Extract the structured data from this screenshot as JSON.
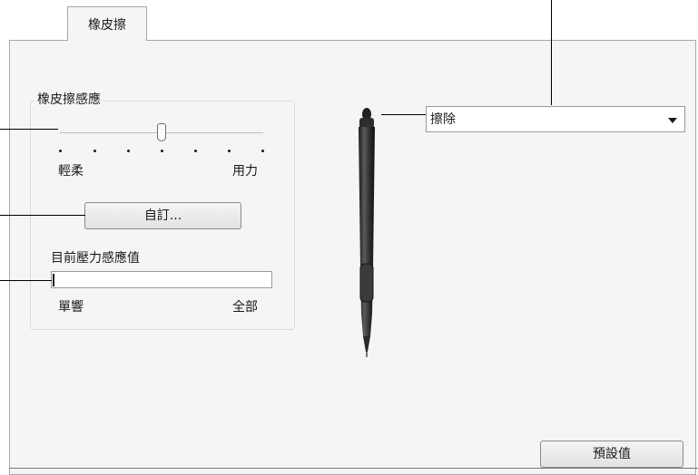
{
  "tab": {
    "label": "橡皮擦"
  },
  "sensitivity": {
    "group_title": "橡皮擦感應",
    "slider_level": 0.5,
    "soft_label": "輕柔",
    "firm_label": "用力",
    "customize_button": "自訂..."
  },
  "pressure": {
    "label": "目前壓力感應值",
    "level": 0.0,
    "min_label": "單響",
    "max_label": "全部"
  },
  "eraser_function": {
    "selected": "擦除"
  },
  "default_button": "預設值"
}
